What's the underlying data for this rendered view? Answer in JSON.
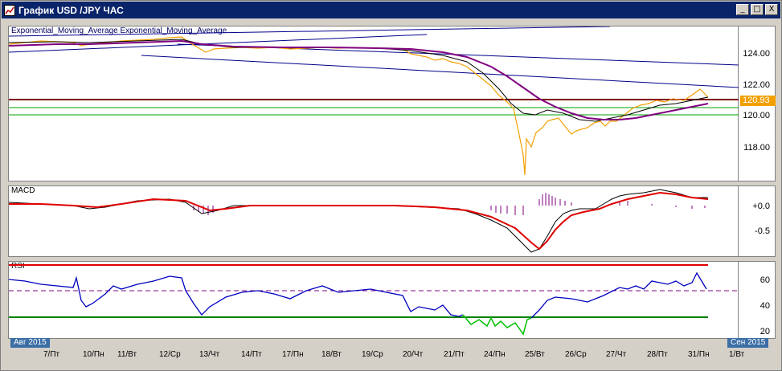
{
  "window": {
    "title": "График USD /JPY ЧАС",
    "minimize_glyph": "_",
    "maximize_glyph": "□",
    "close_glyph": "X"
  },
  "indicators": {
    "main_legend": "Exponential_Moving_Average Exponential_Moving_Average",
    "macd_label": "MACD",
    "rsi_label": "RSI"
  },
  "price_axis": {
    "labels": [
      "124.00",
      "122.00",
      "120.00",
      "118.00"
    ],
    "current_price": "120.93"
  },
  "macd_axis": {
    "labels": [
      "+0.0",
      "-0.5"
    ]
  },
  "rsi_axis": {
    "labels": [
      "60",
      "40",
      "20"
    ]
  },
  "time_axis": {
    "start_label": "Авг 2015",
    "end_label": "Сен 2015",
    "ticks": [
      "7/Пт",
      "10/Пн",
      "11/Вт",
      "12/Ср",
      "13/Чт",
      "14/Пт",
      "17/Пн",
      "18/Вт",
      "19/Ср",
      "20/Чт",
      "21/Пт",
      "24/Пн",
      "25/Вт",
      "26/Ср",
      "27/Чт",
      "28/Пт",
      "31/Пн",
      "1/Вт"
    ]
  },
  "colors": {
    "price": "#f2a000",
    "ema_fast": "#000000",
    "ema_slow": "#800080",
    "trendline": "#00008b",
    "resistance": "#800000",
    "support": "#00a000",
    "macd_signal": "#e00000",
    "rsi": "#0000c0",
    "rsi_oversold": "#00c000",
    "rsi_upper": "#e00000",
    "rsi_lower": "#008000"
  },
  "chart_data": {
    "type": "line",
    "price_ylim": [
      116.5,
      125.5
    ],
    "resistance_levels": [
      121.0
    ],
    "support_levels": [
      120.5,
      120.05
    ],
    "rsi_levels": [
      70,
      50,
      30
    ]
  }
}
